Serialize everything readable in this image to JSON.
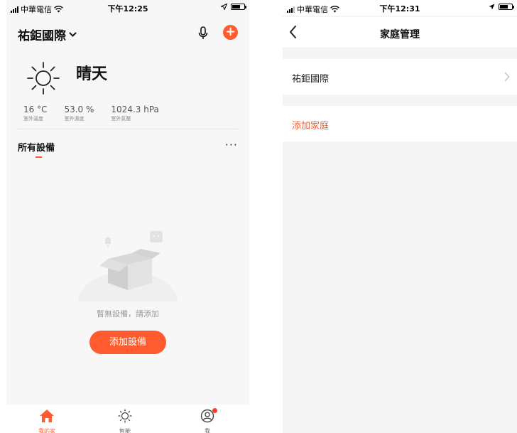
{
  "left": {
    "status": {
      "carrier": "中華電信",
      "time": "下午12:25"
    },
    "home_name": "祐鉅國際",
    "weather": {
      "condition": "晴天",
      "icon": "sun-icon"
    },
    "metrics": [
      {
        "value": "16 °C",
        "label": "室外溫度"
      },
      {
        "value": "53.0 %",
        "label": "室外濕度"
      },
      {
        "value": "1024.3 hPa",
        "label": "室外氣壓"
      }
    ],
    "section_title": "所有設備",
    "empty_text": "暫無設備，請添加",
    "add_device_label": "添加設備",
    "tabs": [
      {
        "label": "我的家",
        "icon": "home-icon",
        "active": true
      },
      {
        "label": "智能",
        "icon": "sun-outline-icon",
        "active": false
      },
      {
        "label": "我",
        "icon": "profile-icon",
        "active": false,
        "badge": true
      }
    ],
    "colors": {
      "accent": "#ff5b2e",
      "background": "#f7f7f7"
    }
  },
  "right": {
    "status": {
      "carrier": "中華電信",
      "time": "下午12:31"
    },
    "nav_title": "家庭管理",
    "homes": [
      {
        "label": "祐鉅國際"
      }
    ],
    "add_home_label": "添加家庭"
  }
}
